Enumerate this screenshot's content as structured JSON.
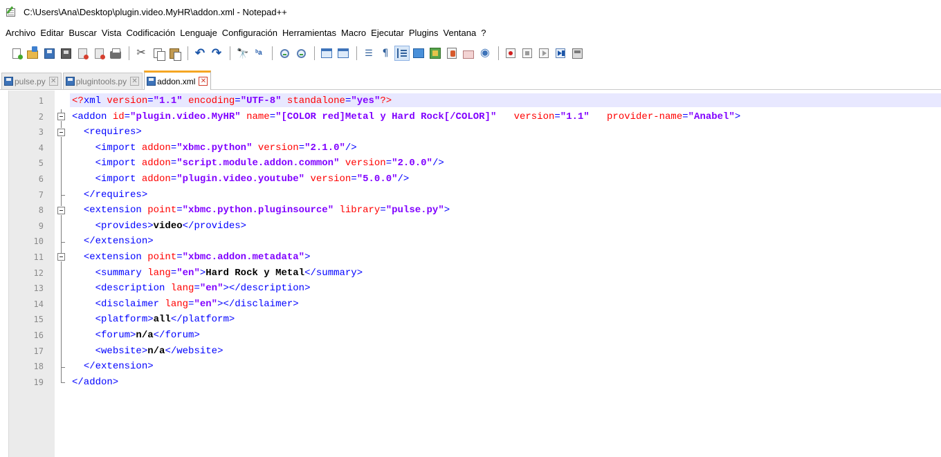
{
  "window": {
    "title": "C:\\Users\\Ana\\Desktop\\plugin.video.MyHR\\addon.xml - Notepad++",
    "app_icon": "notepadpp-icon"
  },
  "menu": [
    "Archivo",
    "Editar",
    "Buscar",
    "Vista",
    "Codificación",
    "Lenguaje",
    "Configuración",
    "Herramientas",
    "Macro",
    "Ejecutar",
    "Plugins",
    "Ventana",
    "?"
  ],
  "toolbar": {
    "groups": [
      [
        "new-file-icon",
        "open-file-icon",
        "save-icon",
        "save-all-icon",
        "close-icon",
        "close-all-icon",
        "print-icon"
      ],
      [
        "cut-icon",
        "copy-icon",
        "paste-icon"
      ],
      [
        "undo-icon",
        "redo-icon"
      ],
      [
        "find-icon",
        "replace-icon"
      ],
      [
        "zoom-in-icon",
        "zoom-out-icon"
      ],
      [
        "sync-vertical-icon",
        "sync-horizontal-icon"
      ],
      [
        "word-wrap-icon",
        "show-all-chars-icon",
        "indent-guide-icon",
        "user-language-icon",
        "document-map-icon",
        "function-list-icon",
        "folder-workspace-icon",
        "monitoring-icon"
      ],
      [
        "record-macro-icon",
        "stop-macro-icon",
        "play-macro-icon",
        "run-macro-multiple-icon",
        "save-macro-icon"
      ]
    ],
    "active_icon": "indent-guide-icon"
  },
  "tabs": [
    {
      "label": "pulse.py",
      "active": false
    },
    {
      "label": "plugintools.py",
      "active": false
    },
    {
      "label": "addon.xml",
      "active": true
    }
  ],
  "editor": {
    "current_line": 1,
    "lines": [
      {
        "n": "1",
        "fold": "none",
        "tokens": [
          [
            "pi",
            "<?"
          ],
          [
            "pitag",
            "xml"
          ],
          [
            "attr",
            " version"
          ],
          [
            "tag",
            "="
          ],
          [
            "val",
            "\"1.1\""
          ],
          [
            "attr",
            " encoding"
          ],
          [
            "tag",
            "="
          ],
          [
            "val",
            "\"UTF-8\""
          ],
          [
            "attr",
            " standalone"
          ],
          [
            "tag",
            "="
          ],
          [
            "val",
            "\"yes\""
          ],
          [
            "pi",
            "?>"
          ]
        ]
      },
      {
        "n": "2",
        "fold": "open",
        "tokens": [
          [
            "tag",
            "<addon"
          ],
          [
            "attr",
            " id"
          ],
          [
            "tag",
            "="
          ],
          [
            "val",
            "\"plugin.video.MyHR\""
          ],
          [
            "attr",
            " name"
          ],
          [
            "tag",
            "="
          ],
          [
            "val",
            "\"[COLOR red]Metal y Hard Rock[/COLOR]\""
          ],
          [
            "attr",
            "   version"
          ],
          [
            "tag",
            "="
          ],
          [
            "val",
            "\"1.1\""
          ],
          [
            "attr",
            "   provider-name"
          ],
          [
            "tag",
            "="
          ],
          [
            "val",
            "\"Anabel\""
          ],
          [
            "tag",
            ">"
          ]
        ]
      },
      {
        "n": "3",
        "fold": "open",
        "tokens": [
          [
            "txt",
            "  "
          ],
          [
            "tag",
            "<requires>"
          ]
        ]
      },
      {
        "n": "4",
        "fold": "mid",
        "tokens": [
          [
            "txt",
            "    "
          ],
          [
            "tag",
            "<import"
          ],
          [
            "attr",
            " addon"
          ],
          [
            "tag",
            "="
          ],
          [
            "val",
            "\"xbmc.python\""
          ],
          [
            "attr",
            " version"
          ],
          [
            "tag",
            "="
          ],
          [
            "val",
            "\"2.1.0\""
          ],
          [
            "tag",
            "/>"
          ]
        ]
      },
      {
        "n": "5",
        "fold": "mid",
        "tokens": [
          [
            "txt",
            "    "
          ],
          [
            "tag",
            "<import"
          ],
          [
            "attr",
            " addon"
          ],
          [
            "tag",
            "="
          ],
          [
            "val",
            "\"script.module.addon.common\""
          ],
          [
            "attr",
            " version"
          ],
          [
            "tag",
            "="
          ],
          [
            "val",
            "\"2.0.0\""
          ],
          [
            "tag",
            "/>"
          ]
        ]
      },
      {
        "n": "6",
        "fold": "mid",
        "tokens": [
          [
            "txt",
            "    "
          ],
          [
            "tag",
            "<import"
          ],
          [
            "attr",
            " addon"
          ],
          [
            "tag",
            "="
          ],
          [
            "val",
            "\"plugin.video.youtube\""
          ],
          [
            "attr",
            " version"
          ],
          [
            "tag",
            "="
          ],
          [
            "val",
            "\"5.0.0\""
          ],
          [
            "tag",
            "/>"
          ]
        ]
      },
      {
        "n": "7",
        "fold": "end",
        "tokens": [
          [
            "txt",
            "  "
          ],
          [
            "tag",
            "</requires>"
          ]
        ]
      },
      {
        "n": "8",
        "fold": "open",
        "tokens": [
          [
            "txt",
            "  "
          ],
          [
            "tag",
            "<extension"
          ],
          [
            "attr",
            " point"
          ],
          [
            "tag",
            "="
          ],
          [
            "val",
            "\"xbmc.python.pluginsource\""
          ],
          [
            "attr",
            " library"
          ],
          [
            "tag",
            "="
          ],
          [
            "val",
            "\"pulse.py\""
          ],
          [
            "tag",
            ">"
          ]
        ]
      },
      {
        "n": "9",
        "fold": "mid",
        "tokens": [
          [
            "txt",
            "    "
          ],
          [
            "tag",
            "<provides>"
          ],
          [
            "txt",
            "video"
          ],
          [
            "tag",
            "</provides>"
          ]
        ]
      },
      {
        "n": "10",
        "fold": "end",
        "tokens": [
          [
            "txt",
            "  "
          ],
          [
            "tag",
            "</extension>"
          ]
        ]
      },
      {
        "n": "11",
        "fold": "open",
        "tokens": [
          [
            "txt",
            "  "
          ],
          [
            "tag",
            "<extension"
          ],
          [
            "attr",
            " point"
          ],
          [
            "tag",
            "="
          ],
          [
            "val",
            "\"xbmc.addon.metadata\""
          ],
          [
            "tag",
            ">"
          ]
        ]
      },
      {
        "n": "12",
        "fold": "mid",
        "tokens": [
          [
            "txt",
            "    "
          ],
          [
            "tag",
            "<summary"
          ],
          [
            "attr",
            " lang"
          ],
          [
            "tag",
            "="
          ],
          [
            "val",
            "\"en\""
          ],
          [
            "tag",
            ">"
          ],
          [
            "txt",
            "Hard Rock y Metal"
          ],
          [
            "tag",
            "</summary>"
          ]
        ]
      },
      {
        "n": "13",
        "fold": "mid",
        "tokens": [
          [
            "txt",
            "    "
          ],
          [
            "tag",
            "<description"
          ],
          [
            "attr",
            " lang"
          ],
          [
            "tag",
            "="
          ],
          [
            "val",
            "\"en\""
          ],
          [
            "tag",
            "></description>"
          ]
        ]
      },
      {
        "n": "14",
        "fold": "mid",
        "tokens": [
          [
            "txt",
            "    "
          ],
          [
            "tag",
            "<disclaimer"
          ],
          [
            "attr",
            " lang"
          ],
          [
            "tag",
            "="
          ],
          [
            "val",
            "\"en\""
          ],
          [
            "tag",
            "></disclaimer>"
          ]
        ]
      },
      {
        "n": "15",
        "fold": "mid",
        "tokens": [
          [
            "txt",
            "    "
          ],
          [
            "tag",
            "<platform>"
          ],
          [
            "txt",
            "all"
          ],
          [
            "tag",
            "</platform>"
          ]
        ]
      },
      {
        "n": "16",
        "fold": "mid",
        "tokens": [
          [
            "txt",
            "    "
          ],
          [
            "tag",
            "<forum>"
          ],
          [
            "txt",
            "n/a"
          ],
          [
            "tag",
            "</forum>"
          ]
        ]
      },
      {
        "n": "17",
        "fold": "mid",
        "tokens": [
          [
            "txt",
            "    "
          ],
          [
            "tag",
            "<website>"
          ],
          [
            "txt",
            "n/a"
          ],
          [
            "tag",
            "</website>"
          ]
        ]
      },
      {
        "n": "18",
        "fold": "end",
        "tokens": [
          [
            "txt",
            "  "
          ],
          [
            "tag",
            "</extension>"
          ]
        ]
      },
      {
        "n": "19",
        "fold": "last",
        "tokens": [
          [
            "tag",
            "</addon>"
          ]
        ]
      }
    ]
  },
  "colors": {
    "tag": "#0000ff",
    "attribute": "#ff0000",
    "value": "#8000ff",
    "current_line_bg": "#e8e8ff",
    "active_tab_accent": "#f5a623",
    "gutter_bg": "#ebebeb"
  }
}
